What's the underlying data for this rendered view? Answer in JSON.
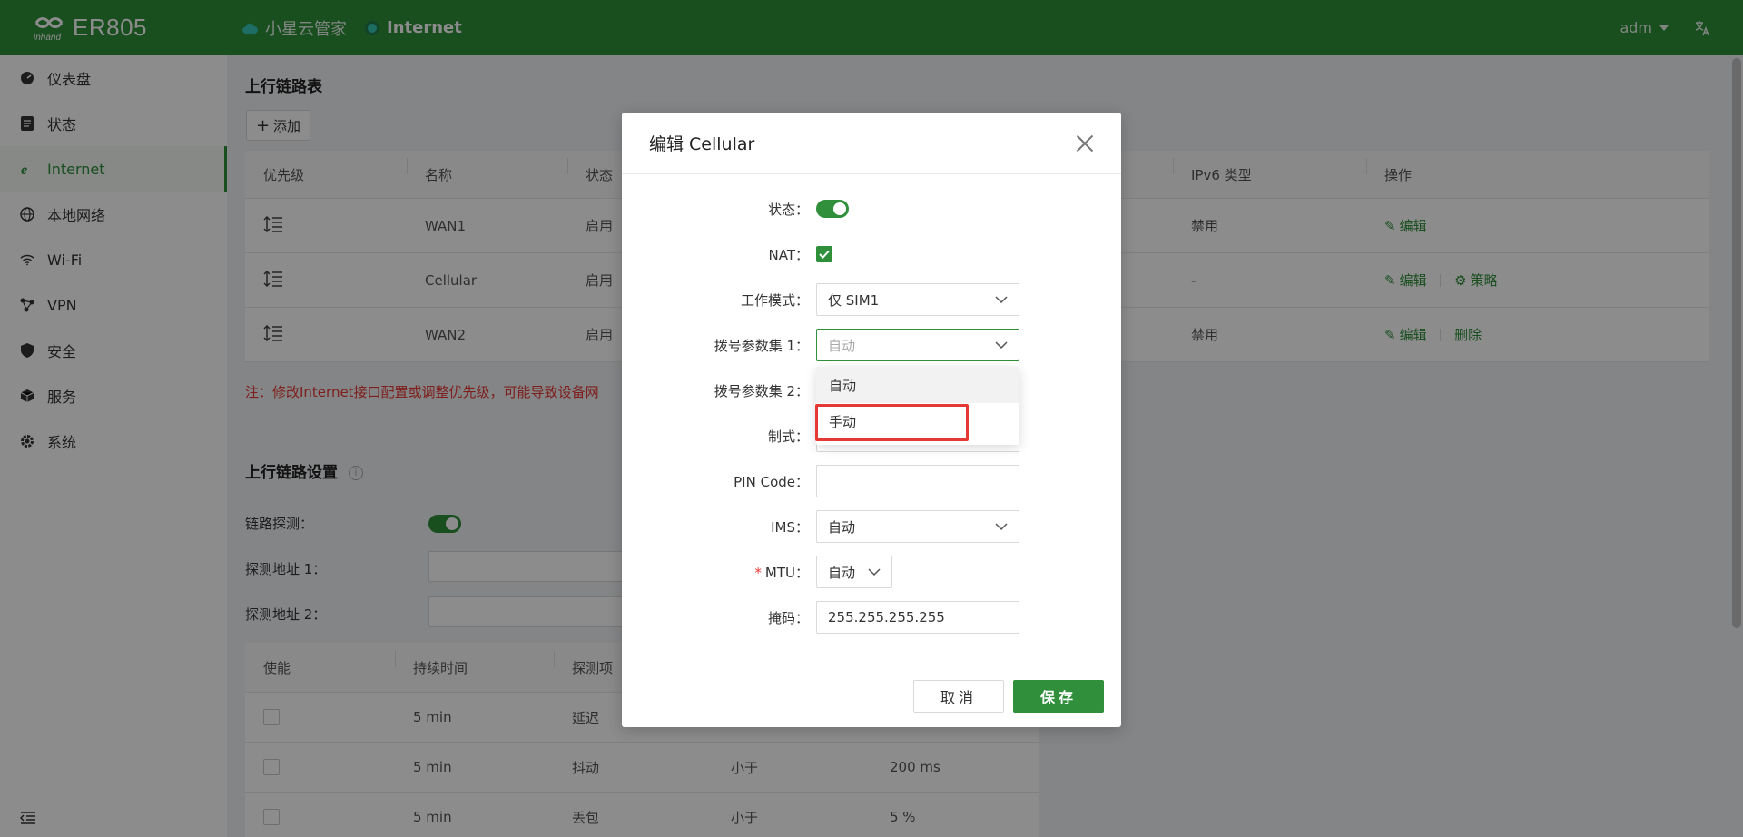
{
  "header": {
    "logo_brand": "inhand",
    "logo_model": "ER805",
    "nav": [
      "小星云管家",
      "Internet"
    ],
    "user": "adm",
    "lang_icon": "translate-icon",
    "color": "#2f8f3a"
  },
  "sidebar": {
    "items": [
      {
        "label": "仪表盘",
        "icon": "dashboard-icon"
      },
      {
        "label": "状态",
        "icon": "status-icon"
      },
      {
        "label": "Internet",
        "icon": "internet-icon",
        "active": true
      },
      {
        "label": "本地网络",
        "icon": "globe-icon"
      },
      {
        "label": "Wi-Fi",
        "icon": "wifi-icon"
      },
      {
        "label": "VPN",
        "icon": "vpn-icon"
      },
      {
        "label": "安全",
        "icon": "shield-icon"
      },
      {
        "label": "服务",
        "icon": "box-icon"
      },
      {
        "label": "系统",
        "icon": "gear-icon"
      }
    ]
  },
  "main": {
    "uplink_title": "上行链路表",
    "add_label": "添加",
    "table": {
      "headers": [
        "优先级",
        "名称",
        "状态",
        "IPv6 类型",
        "操作"
      ],
      "rows": [
        {
          "name": "WAN1",
          "status": "启用",
          "ipv6": "禁用",
          "actions": [
            "编辑"
          ]
        },
        {
          "name": "Cellular",
          "status": "启用",
          "ipv6": "-",
          "actions": [
            "编辑",
            "策略"
          ]
        },
        {
          "name": "WAN2",
          "status": "启用",
          "ipv6": "禁用",
          "actions": [
            "编辑",
            "删除"
          ]
        }
      ]
    },
    "note": "注：修改Internet接口配置或调整优先级，可能导致设备网",
    "settings_title": "上行链路设置",
    "link_detect_label": "链路探测：",
    "probe1_label": "探测地址 1：",
    "probe2_label": "探测地址 2：",
    "detect_table": {
      "headers": [
        "使能",
        "持续时间",
        "探测项"
      ],
      "rows": [
        {
          "duration": "5 min",
          "item": "延迟",
          "cmp": "",
          "value": ""
        },
        {
          "duration": "5 min",
          "item": "抖动",
          "cmp": "小于",
          "value": "200 ms"
        },
        {
          "duration": "5 min",
          "item": "丢包",
          "cmp": "小于",
          "value": "5 %"
        }
      ]
    }
  },
  "modal": {
    "title": "编辑 Cellular",
    "fields": {
      "status_label": "状态：",
      "nat_label": "NAT：",
      "work_mode_label": "工作模式：",
      "work_mode_value": "仅 SIM1",
      "dial1_label": "拨号参数集 1：",
      "dial1_placeholder": "自动",
      "dial2_label": "拨号参数集 2：",
      "mode_label": "制式：",
      "pin_label": "PIN Code：",
      "pin_value": "",
      "ims_label": "IMS：",
      "ims_value": "自动",
      "mtu_label": "MTU：",
      "mtu_value": "自动",
      "mask_label": "掩码：",
      "mask_value": "255.255.255.255"
    },
    "cancel_label": "取消",
    "save_label": "保存"
  },
  "dropdown": {
    "options": [
      "自动",
      "手动"
    ]
  }
}
